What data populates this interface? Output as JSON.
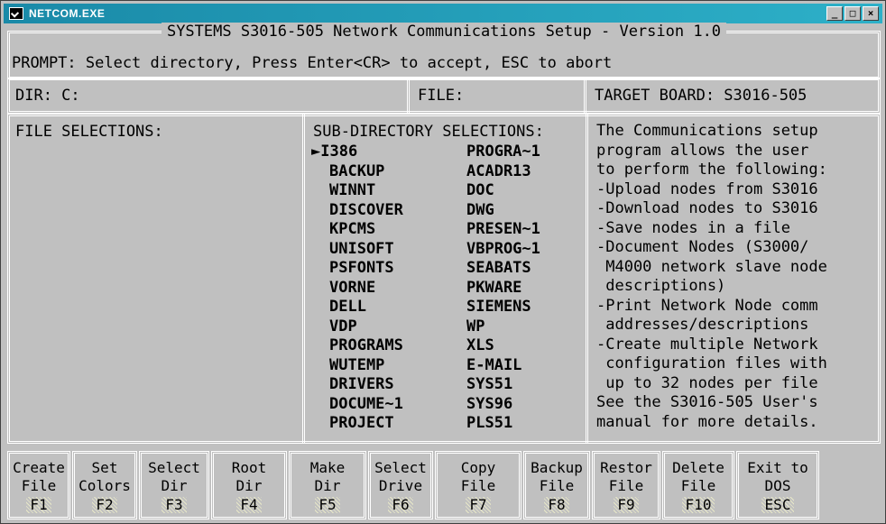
{
  "window": {
    "title": "NETCOM.EXE",
    "buttons": [
      "_",
      "□",
      "×"
    ]
  },
  "header": {
    "title": "SYSTEMS S3016-505 Network Communications Setup - Version 1.0",
    "prompt": "PROMPT: Select directory, Press Enter<CR> to accept, ESC to abort"
  },
  "info": {
    "dir": "DIR: C:",
    "file": "FILE:",
    "target": "TARGET BOARD: S3016-505"
  },
  "file_selections": {
    "heading": "FILE SELECTIONS:"
  },
  "subdirs": {
    "heading": "SUB-DIRECTORY SELECTIONS:",
    "selected_marker": "►",
    "left": [
      "I386",
      "BACKUP",
      "WINNT",
      "DISCOVER",
      "KPCMS",
      "UNISOFT",
      "PSFONTS",
      "VORNE",
      "DELL",
      "VDP",
      "PROGRAMS",
      "WUTEMP",
      "DRIVERS",
      "DOCUME~1",
      "PROJECT"
    ],
    "right": [
      "PROGRA~1",
      "ACADR13",
      "DOC",
      "DWG",
      "PRESEN~1",
      "VBPROG~1",
      "SEABATS",
      "PKWARE",
      "SIEMENS",
      "WP",
      "XLS",
      "E-MAIL",
      "SYS51",
      "SYS96",
      "PLS51"
    ]
  },
  "description": {
    "lines": [
      "The Communications setup",
      "program allows the user",
      "to perform the following:",
      "-Upload nodes from S3016",
      "-Download nodes to S3016",
      "-Save nodes in a file",
      "-Document Nodes (S3000/",
      " M4000 network slave node",
      " descriptions)",
      "-Print Network Node comm",
      " addresses/descriptions",
      "-Create multiple Network",
      " configuration files with",
      " up to 32 nodes per file",
      "See the S3016-505 User's",
      "manual for more details."
    ]
  },
  "fkeys": [
    {
      "l1": "Create",
      "l2": "File",
      "key": "F1"
    },
    {
      "l1": "Set",
      "l2": "Colors",
      "key": "F2"
    },
    {
      "l1": "Select",
      "l2": "Dir",
      "key": "F3"
    },
    {
      "l1": "Root",
      "l2": "Dir",
      "key": "F4"
    },
    {
      "l1": "Make",
      "l2": "Dir",
      "key": "F5"
    },
    {
      "l1": "Select",
      "l2": "Drive",
      "key": "F6"
    },
    {
      "l1": "Copy",
      "l2": "File",
      "key": "F7"
    },
    {
      "l1": "Backup",
      "l2": "File",
      "key": "F8"
    },
    {
      "l1": "Restor",
      "l2": "File",
      "key": "F9"
    },
    {
      "l1": "Delete",
      "l2": "File",
      "key": "F10"
    },
    {
      "l1": "Exit to",
      "l2": "DOS",
      "key": "ESC"
    }
  ]
}
